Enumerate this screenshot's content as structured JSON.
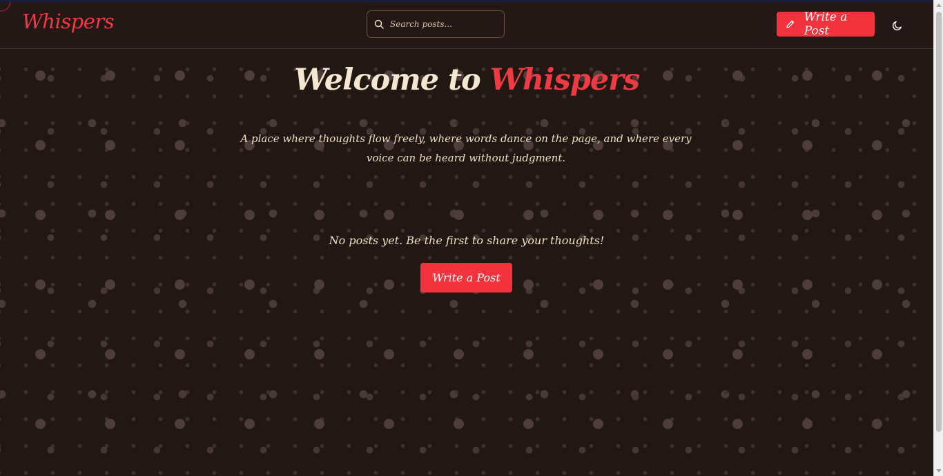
{
  "header": {
    "brand": "Whispers",
    "search_placeholder": "Search posts...",
    "write_button_label": "Write a Post",
    "theme_toggle_icon": "moon-icon"
  },
  "hero": {
    "title_prefix": "Welcome to",
    "title_accent": "Whispers",
    "subtitle": "A place where thoughts flow freely, where words dance on the page, and where every voice can be heard without judgment."
  },
  "feed": {
    "empty_message": "No posts yet. Be the first to share your thoughts!",
    "cta_label": "Write a Post"
  },
  "icons": {
    "search": "search-icon",
    "write": "pencil-icon",
    "theme": "moon-icon"
  },
  "colors": {
    "background": "#211713",
    "accent": "#f2323d",
    "text": "#f1dfc4",
    "dots": "#4e3d3c"
  }
}
